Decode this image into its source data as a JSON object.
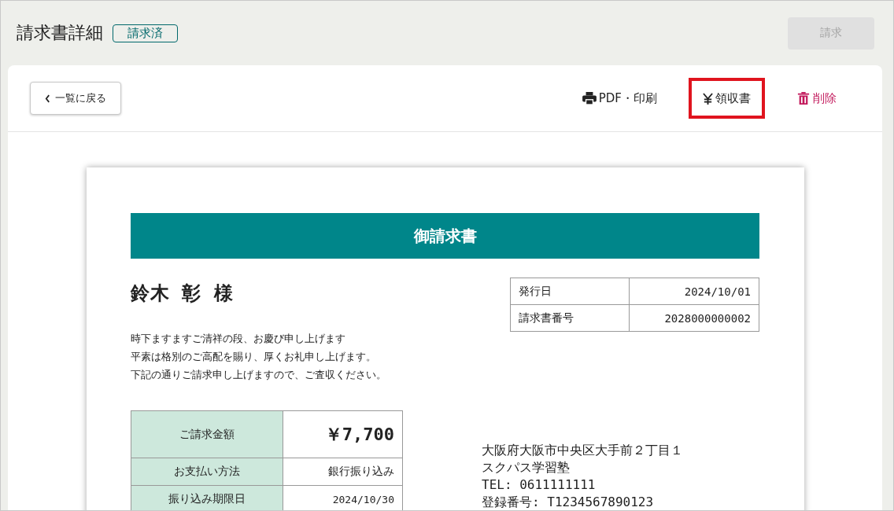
{
  "header": {
    "title": "請求書詳細",
    "status_badge": "請求済",
    "bill_button": {
      "label": "請求",
      "disabled": true
    }
  },
  "toolbar": {
    "back_button": "一覧に戻る",
    "actions": [
      {
        "kind": "print",
        "label": "PDF・印刷",
        "highlighted": false
      },
      {
        "kind": "receipt",
        "label": "領収書",
        "highlighted": true
      },
      {
        "kind": "delete",
        "label": "削除",
        "highlighted": false
      }
    ]
  },
  "invoice": {
    "heading": "御請求書",
    "recipient": "鈴木 彰 様",
    "greeting": [
      "時下ますますご清祥の段、お慶び申し上げます",
      "平素は格別のご高配を賜り、厚くお礼申し上げます。",
      "下記の通りご請求申し上げますので、ご査収ください。"
    ],
    "meta": [
      {
        "label": "発行日",
        "value": "2024/10/01"
      },
      {
        "label": "請求書番号",
        "value": "2028000000002"
      }
    ],
    "summary": [
      {
        "label": "ご請求金額",
        "value": "￥7,700",
        "kind": "total"
      },
      {
        "label": "お支払い方法",
        "value": "銀行振り込み",
        "kind": "text"
      },
      {
        "label": "振り込み期限日",
        "value": "2024/10/30",
        "kind": "date"
      }
    ],
    "issuer": [
      "大阪府大阪市中央区大手前２丁目１",
      "スクパス学習塾",
      "TEL: 0611111111",
      "登録番号: T1234567890123"
    ]
  }
}
